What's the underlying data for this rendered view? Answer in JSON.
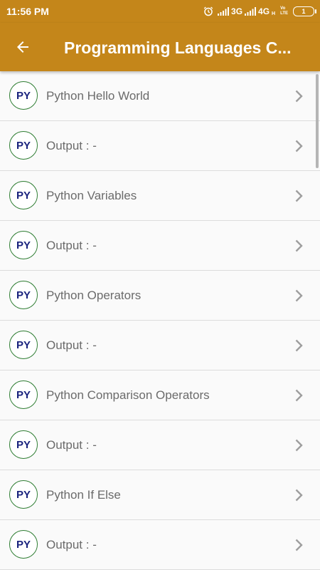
{
  "status_bar": {
    "time": "11:56 PM",
    "network_1": "3G",
    "network_2": "4G",
    "network_2_sub": "H",
    "volte_top": "Vo",
    "volte_bottom": "LTE",
    "battery": "1"
  },
  "app_bar": {
    "title": "Programming Languages C...",
    "back_icon": "arrow-back-icon"
  },
  "avatar_text": "PY",
  "list_items": [
    {
      "label": "Python Hello World"
    },
    {
      "label": "Output : -"
    },
    {
      "label": "Python Variables"
    },
    {
      "label": "Output : -"
    },
    {
      "label": "Python Operators"
    },
    {
      "label": "Output : -"
    },
    {
      "label": "Python Comparison Operators"
    },
    {
      "label": "Output : -"
    },
    {
      "label": "Python If Else"
    },
    {
      "label": "Output : -"
    }
  ],
  "colors": {
    "primary": "#c4861a",
    "avatar_text": "#1a237e",
    "avatar_border": "#2e7d32",
    "item_text": "#6b6b6b",
    "chevron": "#9e9e9e"
  }
}
